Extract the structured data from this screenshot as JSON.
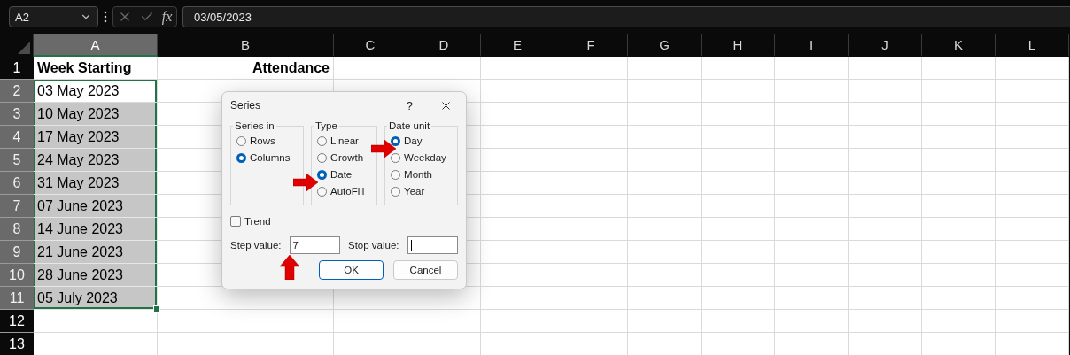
{
  "formula_bar": {
    "name_box": "A2",
    "fx": "fx",
    "formula": "03/05/2023"
  },
  "columns": [
    {
      "label": "A",
      "selected": true
    },
    {
      "label": "B",
      "selected": false
    },
    {
      "label": "C",
      "selected": false
    },
    {
      "label": "D",
      "selected": false
    },
    {
      "label": "E",
      "selected": false
    },
    {
      "label": "F",
      "selected": false
    },
    {
      "label": "G",
      "selected": false
    },
    {
      "label": "H",
      "selected": false
    },
    {
      "label": "I",
      "selected": false
    },
    {
      "label": "J",
      "selected": false
    },
    {
      "label": "K",
      "selected": false
    },
    {
      "label": "L",
      "selected": false
    }
  ],
  "rows": [
    {
      "number": "1",
      "kind": "header",
      "selected": false,
      "active": false,
      "cells": [
        "Week Starting",
        "Attendance"
      ]
    },
    {
      "number": "2",
      "kind": "data",
      "selected": true,
      "active": true,
      "cells": [
        "03 May 2023"
      ]
    },
    {
      "number": "3",
      "kind": "data",
      "selected": true,
      "active": false,
      "cells": [
        "10 May 2023"
      ]
    },
    {
      "number": "4",
      "kind": "data",
      "selected": true,
      "active": false,
      "cells": [
        "17 May 2023"
      ]
    },
    {
      "number": "5",
      "kind": "data",
      "selected": true,
      "active": false,
      "cells": [
        "24 May 2023"
      ]
    },
    {
      "number": "6",
      "kind": "data",
      "selected": true,
      "active": false,
      "cells": [
        "31 May 2023"
      ]
    },
    {
      "number": "7",
      "kind": "data",
      "selected": true,
      "active": false,
      "cells": [
        "07 June 2023"
      ]
    },
    {
      "number": "8",
      "kind": "data",
      "selected": true,
      "active": false,
      "cells": [
        "14 June 2023"
      ]
    },
    {
      "number": "9",
      "kind": "data",
      "selected": true,
      "active": false,
      "cells": [
        "21 June 2023"
      ]
    },
    {
      "number": "10",
      "kind": "data",
      "selected": true,
      "active": false,
      "cells": [
        "28 June 2023"
      ]
    },
    {
      "number": "11",
      "kind": "data",
      "selected": true,
      "active": false,
      "cells": [
        "05 July 2023"
      ]
    },
    {
      "number": "12",
      "kind": "data",
      "selected": false,
      "active": false,
      "cells": []
    },
    {
      "number": "13",
      "kind": "data",
      "selected": false,
      "active": false,
      "cells": []
    }
  ],
  "dialog": {
    "title": "Series",
    "help": "?",
    "groups": [
      {
        "label": "Series in",
        "options": [
          {
            "label": "Rows",
            "selected": false
          },
          {
            "label": "Columns",
            "selected": true
          }
        ]
      },
      {
        "label": "Type",
        "options": [
          {
            "label": "Linear",
            "selected": false
          },
          {
            "label": "Growth",
            "selected": false
          },
          {
            "label": "Date",
            "selected": true
          },
          {
            "label": "AutoFill",
            "selected": false
          }
        ]
      },
      {
        "label": "Date unit",
        "options": [
          {
            "label": "Day",
            "selected": true
          },
          {
            "label": "Weekday",
            "selected": false
          },
          {
            "label": "Month",
            "selected": false
          },
          {
            "label": "Year",
            "selected": false
          }
        ]
      }
    ],
    "trend": {
      "label": "Trend",
      "checked": false
    },
    "step": {
      "label": "Step value:",
      "value": "7"
    },
    "stop": {
      "label": "Stop value:"
    },
    "buttons": [
      {
        "label": "OK",
        "kind": "default"
      },
      {
        "label": "Cancel",
        "kind": "normal"
      }
    ]
  }
}
